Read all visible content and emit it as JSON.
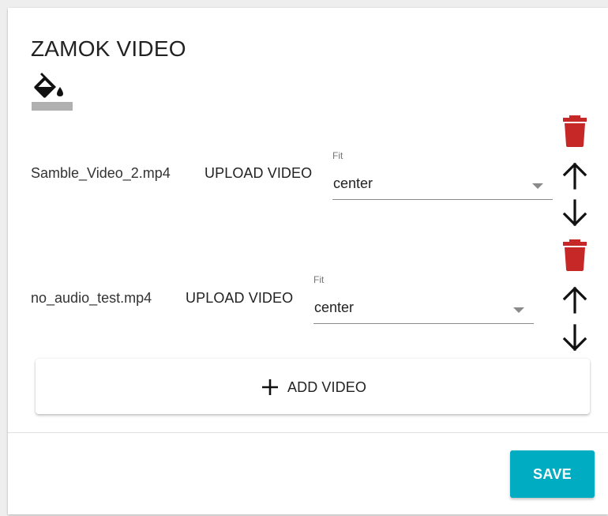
{
  "panel": {
    "title": "ZAMOK VIDEO",
    "icon": "format-color-fill-icon"
  },
  "videos": [
    {
      "filename": "Samble_Video_2.mp4",
      "upload_label": "UPLOAD VIDEO",
      "fit_label": "Fit",
      "fit_value": "center"
    },
    {
      "filename": "no_audio_test.mp4",
      "upload_label": "UPLOAD VIDEO",
      "fit_label": "Fit",
      "fit_value": "center"
    }
  ],
  "add_video": {
    "label": "ADD VIDEO",
    "icon": "plus-icon"
  },
  "footer": {
    "save_label": "SAVE"
  },
  "colors": {
    "delete": "#c62828",
    "accent": "#00acc1"
  }
}
